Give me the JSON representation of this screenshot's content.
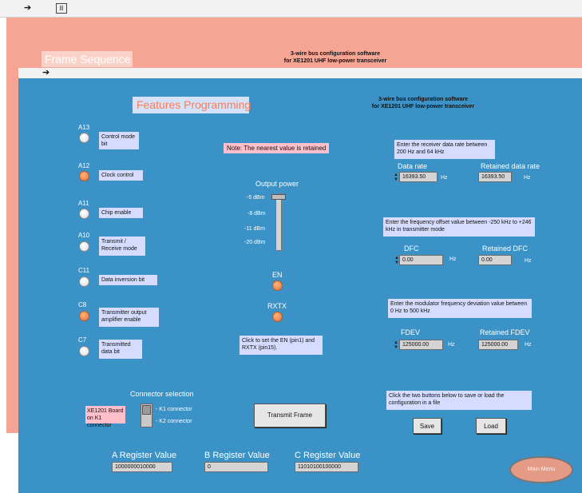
{
  "back_window": {
    "title": "Frame Sequence",
    "header_line1": "3-wire bus configuration software",
    "header_line2": "for XE1201 UHF low-power transceiver"
  },
  "front_window": {
    "title": "Features Programming",
    "header_line1": "3-wire bus configuration software",
    "header_line2": "for XE1201 UHF low-power transceiver",
    "note": "Note: The nearest value is retained",
    "bits": [
      {
        "code": "A13",
        "label": "Control mode bit",
        "state": "off"
      },
      {
        "code": "A12",
        "label": "Clock control",
        "state": "on"
      },
      {
        "code": "A11",
        "label": "Chip enable",
        "state": "off"
      },
      {
        "code": "A10",
        "label": "Transmit / Receive mode",
        "state": "off"
      },
      {
        "code": "C11",
        "label": "Data inversion bit",
        "state": "off"
      },
      {
        "code": "C8",
        "label": "Transmitter output amplifier enable",
        "state": "on"
      },
      {
        "code": "C7",
        "label": "Transmitted data bit",
        "state": "off"
      }
    ],
    "output_power": {
      "label": "Output power",
      "levels": [
        "-5 dBm",
        "-8 dBm",
        "-11 dBm",
        "-20 dBm"
      ],
      "selected": "-5 dBm"
    },
    "en": {
      "label": "EN",
      "state": "on"
    },
    "rxtx": {
      "label": "RXTX",
      "state": "on"
    },
    "pin_note": "Click to set the EN (pin1) and RXTX (pin15).",
    "data_rate": {
      "prompt": "Enter the receiver data rate between 200 Hz and 64 kHz",
      "label": "Data rate",
      "value": "16393.50",
      "unit": "Hz",
      "retained_label": "Retained data rate",
      "retained_value": "16393.50",
      "retained_unit": "Hz"
    },
    "dfc": {
      "prompt": "Enter the frequency offset value between -250 kHz to +246 kHz in transmitter mode",
      "label": "DFC",
      "value": "0.00",
      "unit": "Hz",
      "retained_label": "Retained DFC",
      "retained_value": "0.00",
      "retained_unit": "Hz"
    },
    "fdev": {
      "prompt": "Enter the modulator frequency deviation value between 0 Hz to 500 kHz",
      "label": "FDEV",
      "value": "125000.00",
      "unit": "Hz",
      "retained_label": "Retained FDEV",
      "retained_value": "125000.00",
      "retained_unit": "Hz"
    },
    "connector": {
      "label": "Connector selection",
      "board_text": "XE1201 Board on K1 connector",
      "options": [
        "- K1 connector",
        "- K2 connector"
      ]
    },
    "transmit_button": "Transmit Frame",
    "save_load_note": "Click the two buttons below to save or load the configuration in a file",
    "save_button": "Save",
    "load_button": "Load",
    "registers": {
      "a_label": "A Register Value",
      "a_value": "1000000010000",
      "b_label": "B Register Value",
      "b_value": "0",
      "c_label": "C Register Value",
      "c_value": "11010100100000"
    },
    "main_menu": "Main Menu"
  },
  "colors": {
    "back_panel": "#f6a493",
    "front_panel": "#3a92c6",
    "label_bg": "#d6dcff",
    "note_bg": "#ffc0cb",
    "led_on": "#e0743d"
  },
  "icons": [
    "run-arrow-icon",
    "pause-icon"
  ]
}
